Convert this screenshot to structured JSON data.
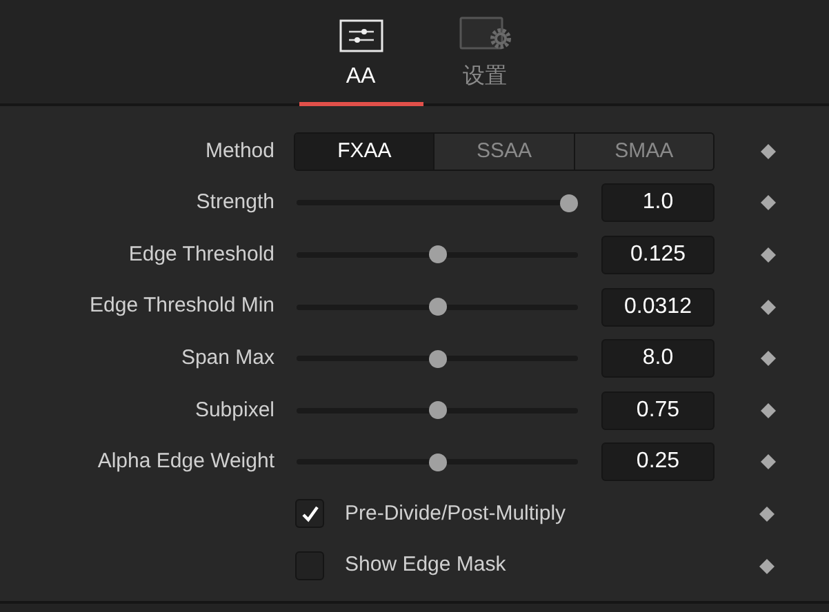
{
  "tabs": [
    {
      "label": "AA",
      "kind": "sliders",
      "selected": true
    },
    {
      "label": "设置",
      "kind": "settings",
      "selected": false
    }
  ],
  "method": {
    "label": "Method",
    "options": [
      {
        "label": "FXAA",
        "selected": true
      },
      {
        "label": "SSAA",
        "selected": false
      },
      {
        "label": "SMAA",
        "selected": false
      }
    ]
  },
  "sliders": [
    {
      "label": "Strength",
      "level": 1,
      "value": "1.0"
    },
    {
      "label": "Edge Threshold",
      "level": 0.5,
      "value": "0.125"
    },
    {
      "label": "Edge Threshold Min",
      "level": 0.5,
      "value": "0.0312"
    },
    {
      "label": "Span Max",
      "level": 0.5,
      "value": "8.0"
    },
    {
      "label": "Subpixel",
      "level": 0.5,
      "value": "0.75"
    },
    {
      "label": "Alpha Edge Weight",
      "level": 0.5,
      "value": "0.25"
    }
  ],
  "checkboxes": [
    {
      "label": "Pre-Divide/Post-Multiply",
      "checked": true
    },
    {
      "label": "Show Edge Mask",
      "checked": false
    }
  ]
}
